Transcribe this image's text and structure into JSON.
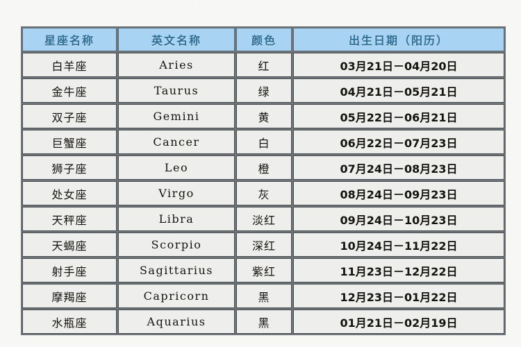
{
  "page": {
    "background_color": "#f7f7f5",
    "top_artifact_text": "· · · ·   · ·    · ·"
  },
  "table": {
    "header_background": "#a9d3f2",
    "header_text_color": "#2f6f96",
    "cell_background": "#eeeeec",
    "border_color": "#4a4f52",
    "columns": [
      "星座名称",
      "英文名称",
      "颜色",
      "出生日期（阳历）"
    ],
    "rows": [
      {
        "name": "白羊座",
        "english": "Aries",
        "color": "红",
        "date": "03月21日－04月20日"
      },
      {
        "name": "金牛座",
        "english": "Taurus",
        "color": "绿",
        "date": "04月21日－05月21日"
      },
      {
        "name": "双子座",
        "english": "Gemini",
        "color": "黄",
        "date": "05月22日－06月21日"
      },
      {
        "name": "巨蟹座",
        "english": "Cancer",
        "color": "白",
        "date": "06月22日－07月23日"
      },
      {
        "name": "狮子座",
        "english": "Leo",
        "color": "橙",
        "date": "07月24日－08月23日"
      },
      {
        "name": "处女座",
        "english": "Virgo",
        "color": "灰",
        "date": "08月24日－09月23日"
      },
      {
        "name": "天秤座",
        "english": "Libra",
        "color": "淡红",
        "date": "09月24日－10月23日"
      },
      {
        "name": "天蝎座",
        "english": "Scorpio",
        "color": "深红",
        "date": "10月24日－11月22日"
      },
      {
        "name": "射手座",
        "english": "Sagittarius",
        "color": "紫红",
        "date": "11月23日－12月22日"
      },
      {
        "name": "摩羯座",
        "english": "Capricorn",
        "color": "黑",
        "date": "12月23日－01月22日"
      },
      {
        "name": "水瓶座",
        "english": "Aquarius",
        "color": "黑",
        "date": "01月21日－02月19日"
      }
    ]
  }
}
